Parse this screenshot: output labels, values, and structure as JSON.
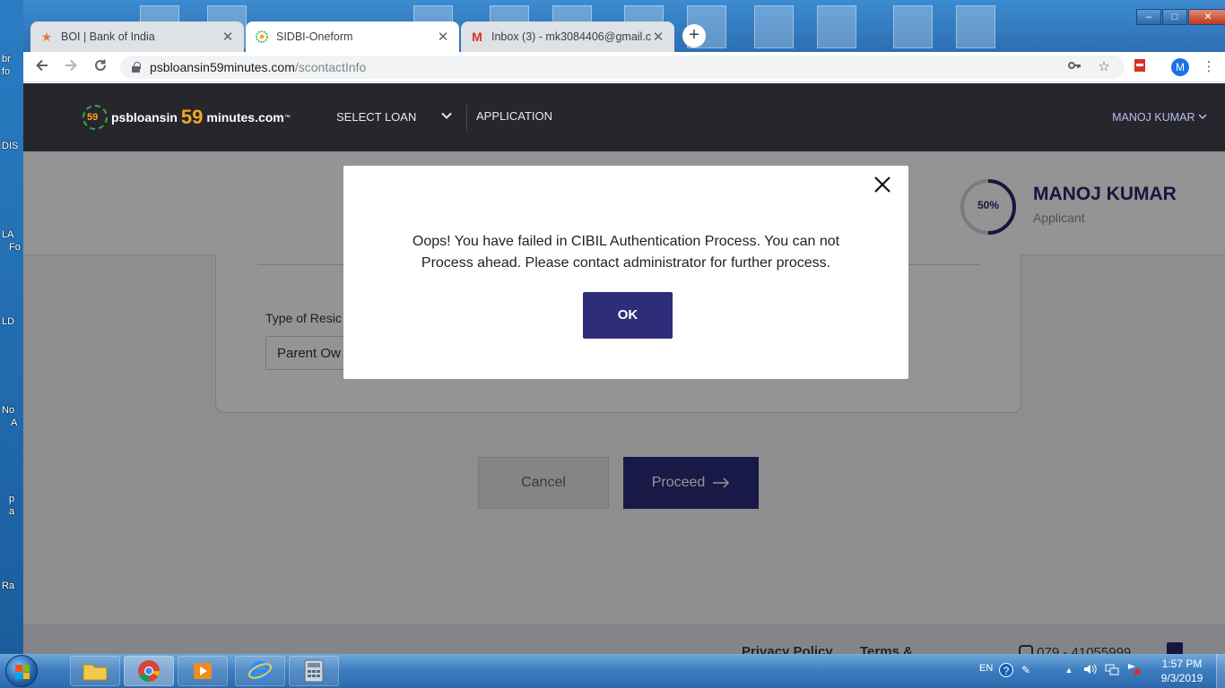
{
  "desktop": {
    "labels": [
      "br",
      "fo",
      "DIS",
      "LA",
      "Fo",
      "LD",
      "No",
      "A",
      "p",
      "a",
      "Ra"
    ]
  },
  "browser": {
    "tabs": [
      {
        "title": "BOI | Bank of India",
        "favicon": "star-icon"
      },
      {
        "title": "SIDBI-Oneform",
        "favicon": "psb-logo-icon"
      },
      {
        "title": "Inbox (3) - mk3084406@gmail.co",
        "favicon": "gmail-icon"
      }
    ],
    "new_tab_symbol": "+",
    "window_controls": {
      "minimize": "–",
      "maximize": "□",
      "close": "✕"
    },
    "url_host": "psbloansin59minutes.com",
    "url_path": "/scontactInfo",
    "profile_initial": "M"
  },
  "site": {
    "logo": {
      "badge": "59",
      "part1": "psbloansin",
      "number": "59",
      "part2": "minutes.com",
      "tm": "™"
    },
    "nav": {
      "select_loan": "SELECT LOAN",
      "application": "APPLICATION"
    },
    "user_menu": "MANOJ KUMAR",
    "progress": {
      "value": 50,
      "label": "50%"
    },
    "applicant": {
      "name": "MANOJ KUMAR",
      "role": "Applicant"
    },
    "form": {
      "field_label": "Type of Resic",
      "field_value": "Parent Ow"
    },
    "buttons": {
      "cancel": "Cancel",
      "proceed": "Proceed"
    },
    "footer": {
      "privacy": "Privacy Policy",
      "terms": "Terms &",
      "phone": "079 - 41055999"
    },
    "colors": {
      "header_bg": "#26262c",
      "primary": "#2b2b7a",
      "logo_accent": "#f5a623"
    }
  },
  "modal": {
    "message": "Oops! You have failed in CIBIL Authentication Process. You can not Process ahead. Please contact administrator for further process.",
    "ok_label": "OK"
  },
  "taskbar": {
    "language": "EN",
    "time": "1:57 PM",
    "date": "9/3/2019"
  }
}
